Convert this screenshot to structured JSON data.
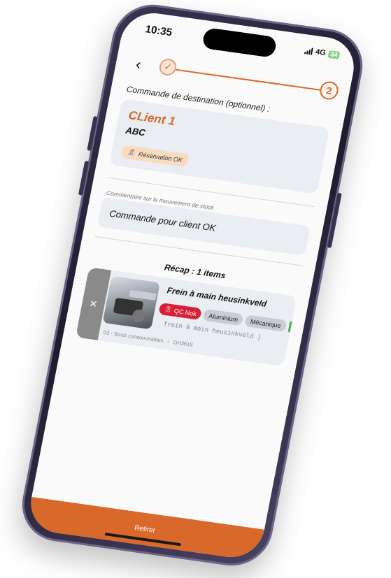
{
  "status_bar": {
    "time": "10:35",
    "network": "4G",
    "battery": "34"
  },
  "stepper": {
    "step_done_icon": "checkmark-icon",
    "step_current": "2"
  },
  "destination": {
    "label": "Commande de destination (optionnel) :",
    "client_name": "CLient 1",
    "client_code": "ABC",
    "reservation_label": "Réservation OK"
  },
  "comment": {
    "label": "Commentaire sur le mouvement de stock",
    "value": "Commande pour client OK"
  },
  "recap": {
    "title": "Récap : 1 items",
    "items": [
      {
        "name": "Frein à main heusinkveld",
        "tags": [
          "QC Nok",
          "Aluminium",
          "Mécanique"
        ],
        "serial": "frein à main heusinkveld",
        "location": "03 - Stock consommables",
        "reference": "GH3618"
      }
    ]
  },
  "action": {
    "label": "Retirer"
  },
  "colors": {
    "accent": "#d9692b",
    "qc_nok": "#d81f36",
    "card": "#eaedf2"
  }
}
